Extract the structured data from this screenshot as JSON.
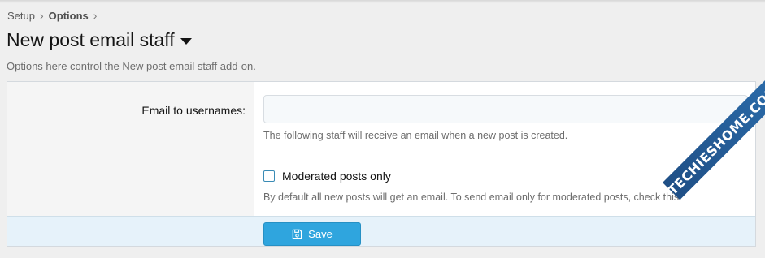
{
  "breadcrumb": {
    "items": [
      "Setup",
      "Options"
    ],
    "separator": "›"
  },
  "page": {
    "title": "New post email staff",
    "description": "Options here control the New post email staff add-on."
  },
  "form": {
    "email_label": "Email to usernames:",
    "email_value": "",
    "email_hint": "The following staff will receive an email when a new post is created.",
    "moderated_label": "Moderated posts only",
    "moderated_checked": false,
    "moderated_hint": "By default all new posts will get an email. To send email only for moderated posts, check this.",
    "save_label": "Save"
  },
  "watermark": {
    "text": "TECHIESHOME.COM"
  },
  "colors": {
    "accent": "#2fa5de",
    "footer_bg": "#e6f2fa",
    "page_bg": "#efefef"
  }
}
